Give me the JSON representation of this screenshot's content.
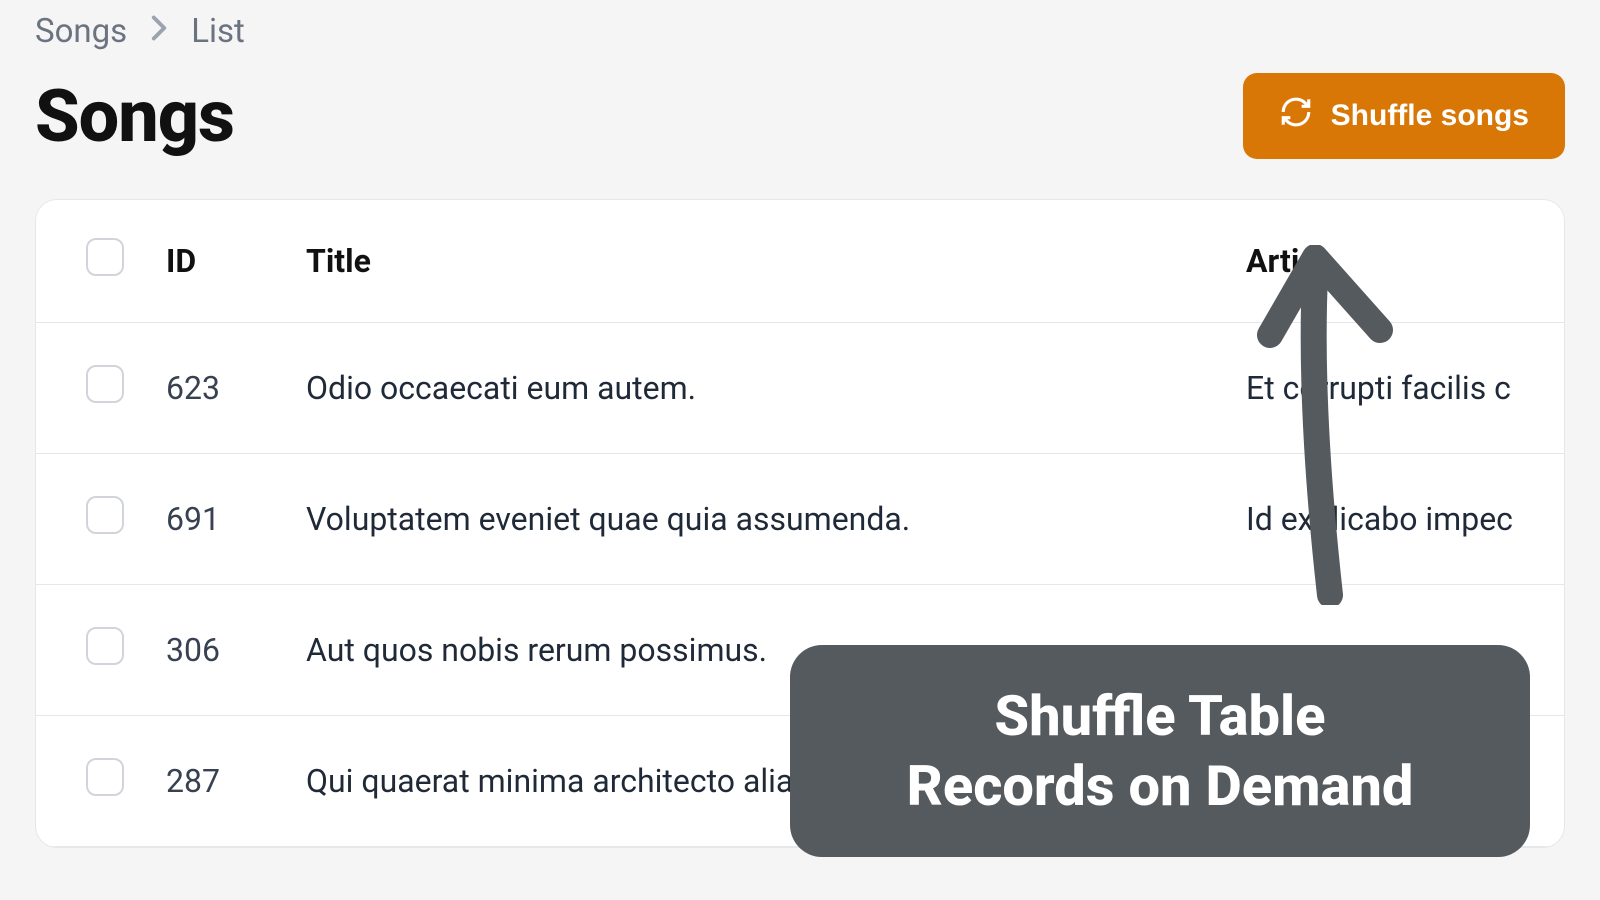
{
  "breadcrumb": {
    "root": "Songs",
    "leaf": "List"
  },
  "page": {
    "title": "Songs"
  },
  "actions": {
    "shuffle_label": "Shuffle songs"
  },
  "table": {
    "headers": {
      "id": "ID",
      "title": "Title",
      "artist": "Artist"
    },
    "rows": [
      {
        "id": "623",
        "title": "Odio occaecati eum autem.",
        "artist": "Et corrupti facilis c"
      },
      {
        "id": "691",
        "title": "Voluptatem eveniet quae quia assumenda.",
        "artist": "Id explicabo impec"
      },
      {
        "id": "306",
        "title": "Aut quos nobis rerum possimus.",
        "artist": ""
      },
      {
        "id": "287",
        "title": "Qui quaerat minima architecto alia",
        "artist": ""
      }
    ]
  },
  "annotation": {
    "line1": "Shuffle Table",
    "line2": "Records on Demand"
  }
}
